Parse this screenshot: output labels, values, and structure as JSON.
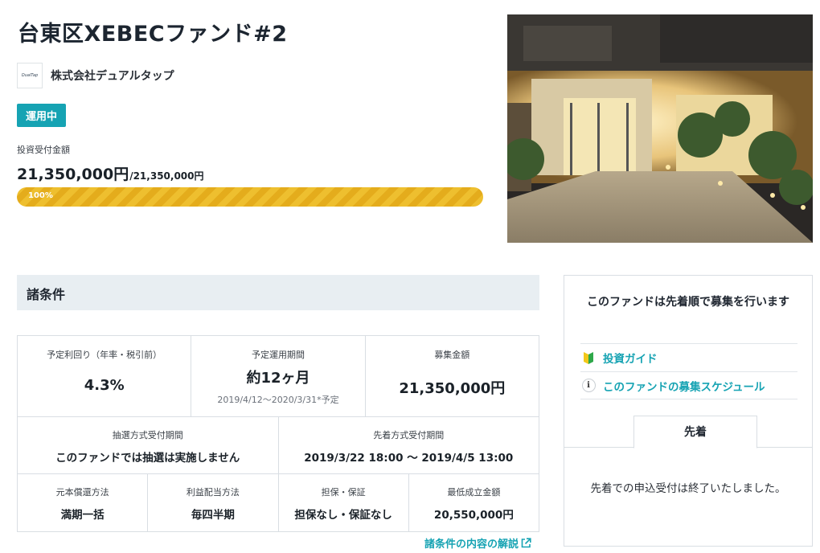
{
  "fund": {
    "title": "台東区XEBECファンド#2",
    "company_logo_text": "DualTap",
    "company": "株式会社デュアルタップ",
    "status": "運用中",
    "amount_label": "投資受付金額",
    "amount_raised": "21,350,000円",
    "amount_total": "/21,350,000円",
    "progress_text": "100%",
    "progress": 1.0
  },
  "conditions": {
    "heading": "諸条件",
    "yield_label": "予定利回り（年率・税引前）",
    "yield_value": "4.3%",
    "period_label": "予定運用期間",
    "period_value": "約12ヶ月",
    "period_dates": "2019/4/12〜2020/3/31*予定",
    "raise_label": "募集金額",
    "raise_value": "21,350,000円",
    "lottery_label": "抽選方式受付期間",
    "lottery_value": "このファンドでは抽選は実施しません",
    "fcfs_label": "先着方式受付期間",
    "fcfs_value": "2019/3/22 18:00 〜 2019/4/5 13:00",
    "repay_label": "元本償還方法",
    "repay_value": "満期一括",
    "dividend_label": "利益配当方法",
    "dividend_value": "毎四半期",
    "collateral_label": "担保・保証",
    "collateral_value": "担保なし・保証なし",
    "min_label": "最低成立金額",
    "min_value": "20,550,000円",
    "explain_link": "諸条件の内容の解説"
  },
  "side": {
    "notice": "このファンドは先着順で募集を行います",
    "guide_link": "投資ガイド",
    "schedule_link": "このファンドの募集スケジュール",
    "info_glyph": "i",
    "tab": "先着",
    "message": "先着での申込受付は終了いたしました。"
  },
  "colors": {
    "accent": "#16a3b3",
    "progress": "#eebf2f",
    "section_bg": "#e8eef2"
  }
}
